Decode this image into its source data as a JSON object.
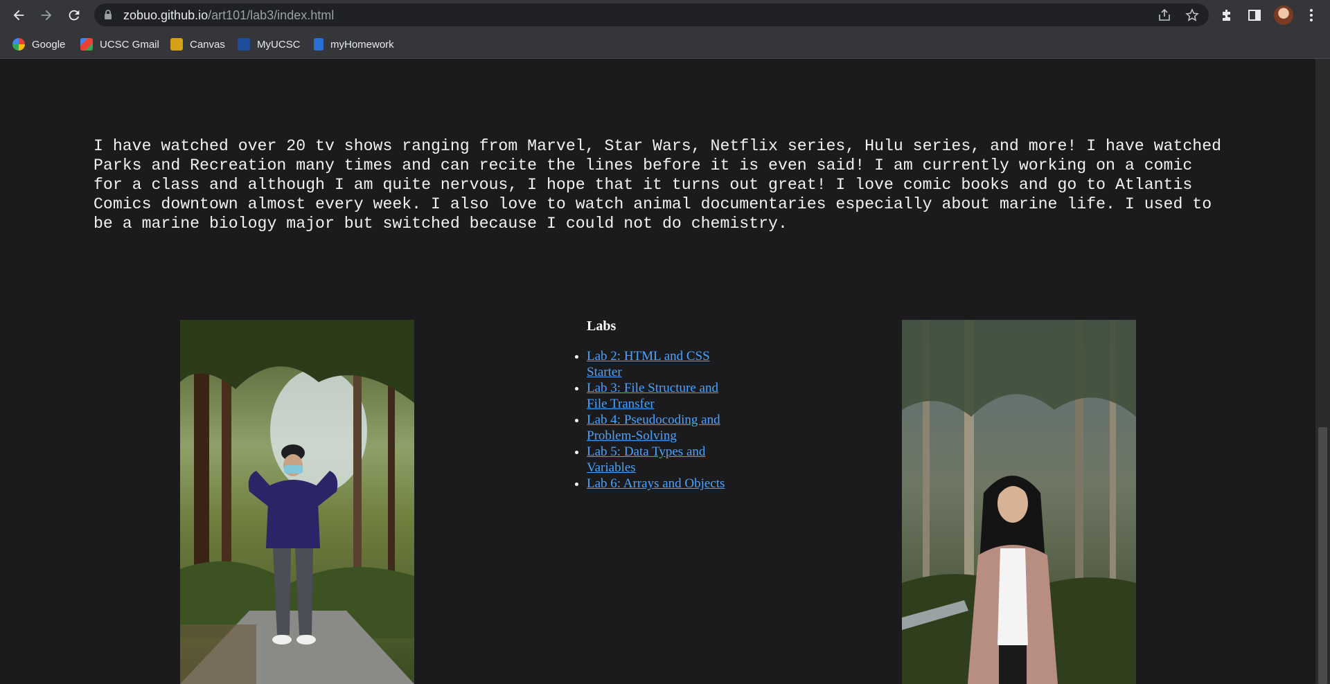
{
  "browser": {
    "url_domain": "zobuo.github.io",
    "url_path": "/art101/lab3/index.html",
    "bookmarks": [
      {
        "label": "Google",
        "color": "#4285f4"
      },
      {
        "label": "UCSC Gmail",
        "color": "#ea4335"
      },
      {
        "label": "Canvas",
        "color": "#d4a017"
      },
      {
        "label": "MyUCSC",
        "color": "#1f4e9c"
      },
      {
        "label": "myHomework",
        "color": "#2a6fd6"
      }
    ]
  },
  "bio": {
    "text": "I have watched over 20 tv shows ranging from Marvel, Star Wars, Netflix series, Hulu series, and more! I have watched Parks and Recreation many times and can recite the lines before it is even said! I am currently working on a comic for a class and although I am quite nervous, I hope that it turns out great! I love comic books and go to Atlantis Comics downtown almost every week. I also love to watch animal documentaries especially about marine life. I used to be a marine biology major but switched because I could not do chemistry."
  },
  "labs": {
    "heading": "Labs",
    "items": [
      {
        "label": "Lab 2: HTML and CSS Starter"
      },
      {
        "label": "Lab 3: File Structure and File Transfer"
      },
      {
        "label": "Lab 4: Pseudocoding and Problem-Solving"
      },
      {
        "label": "Lab 5: Data Types and Variables"
      },
      {
        "label": "Lab 6: Arrays and Objects"
      }
    ]
  },
  "colors": {
    "page_bg": "#1b1b1d",
    "link": "#4aa3ff",
    "chrome_bg": "#35363a"
  }
}
